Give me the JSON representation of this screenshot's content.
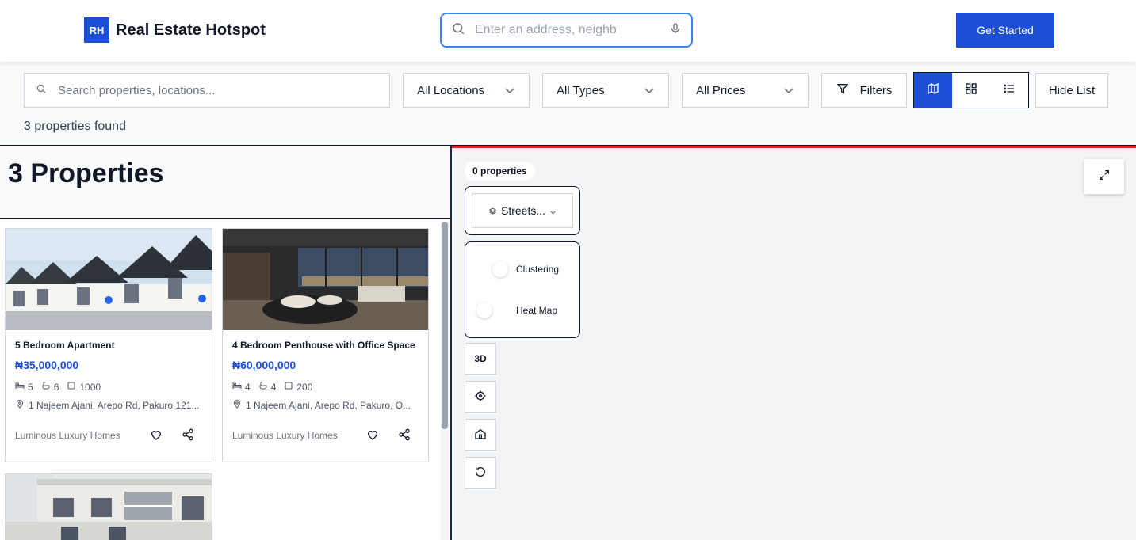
{
  "brand": {
    "mark": "RH",
    "name": "Real Estate Hotspot"
  },
  "header": {
    "search_placeholder": "Enter an address, neighb",
    "cta_label": "Get Started"
  },
  "filters": {
    "search_placeholder": "Search properties, locations...",
    "location": "All Locations",
    "type": "All Types",
    "price": "All Prices",
    "filters_label": "Filters",
    "hide_list_label": "Hide List",
    "result_count": "3 properties found"
  },
  "list": {
    "heading": "3 Properties",
    "cards": [
      {
        "title": "5 Bedroom Apartment",
        "price": "₦35,000,000",
        "beds": "5",
        "baths": "6",
        "area": "1000",
        "address": "1 Najeem Ajani, Arepo Rd, Pakuro 121...",
        "agent": "Luminous Luxury Homes"
      },
      {
        "title": "4 Bedroom Penthouse with Office Space",
        "price": "₦60,000,000",
        "beds": "4",
        "baths": "4",
        "area": "200",
        "address": "1 Najeem Ajani, Arepo Rd, Pakuro, O...",
        "agent": "Luminous Luxury Homes"
      }
    ]
  },
  "map": {
    "count_badge": "0 properties",
    "style_label": "Streets...",
    "clustering_label": "Clustering",
    "heatmap_label": "Heat Map",
    "three_d_label": "3D"
  },
  "colors": {
    "primary": "#1d4ed8",
    "map_border": "#dc2626"
  }
}
